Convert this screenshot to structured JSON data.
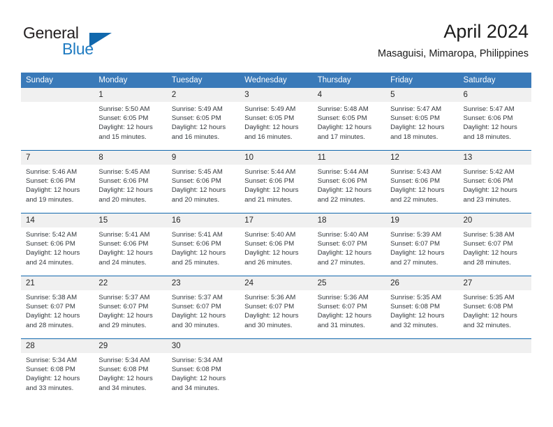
{
  "brand": {
    "name_part1": "General",
    "name_part2": "Blue"
  },
  "header": {
    "month_title": "April 2024",
    "location": "Masaguisi, Mimaropa, Philippines"
  },
  "colors": {
    "header_blue": "#3a7ab9",
    "accent_blue": "#1168ad",
    "daynum_bg": "#f0f0f0"
  },
  "weekday_headers": [
    "Sunday",
    "Monday",
    "Tuesday",
    "Wednesday",
    "Thursday",
    "Friday",
    "Saturday"
  ],
  "weeks": [
    [
      {
        "day": "",
        "sunrise": "",
        "sunset": "",
        "daylight1": "",
        "daylight2": ""
      },
      {
        "day": "1",
        "sunrise": "Sunrise: 5:50 AM",
        "sunset": "Sunset: 6:05 PM",
        "daylight1": "Daylight: 12 hours",
        "daylight2": "and 15 minutes."
      },
      {
        "day": "2",
        "sunrise": "Sunrise: 5:49 AM",
        "sunset": "Sunset: 6:05 PM",
        "daylight1": "Daylight: 12 hours",
        "daylight2": "and 16 minutes."
      },
      {
        "day": "3",
        "sunrise": "Sunrise: 5:49 AM",
        "sunset": "Sunset: 6:05 PM",
        "daylight1": "Daylight: 12 hours",
        "daylight2": "and 16 minutes."
      },
      {
        "day": "4",
        "sunrise": "Sunrise: 5:48 AM",
        "sunset": "Sunset: 6:05 PM",
        "daylight1": "Daylight: 12 hours",
        "daylight2": "and 17 minutes."
      },
      {
        "day": "5",
        "sunrise": "Sunrise: 5:47 AM",
        "sunset": "Sunset: 6:05 PM",
        "daylight1": "Daylight: 12 hours",
        "daylight2": "and 18 minutes."
      },
      {
        "day": "6",
        "sunrise": "Sunrise: 5:47 AM",
        "sunset": "Sunset: 6:06 PM",
        "daylight1": "Daylight: 12 hours",
        "daylight2": "and 18 minutes."
      }
    ],
    [
      {
        "day": "7",
        "sunrise": "Sunrise: 5:46 AM",
        "sunset": "Sunset: 6:06 PM",
        "daylight1": "Daylight: 12 hours",
        "daylight2": "and 19 minutes."
      },
      {
        "day": "8",
        "sunrise": "Sunrise: 5:45 AM",
        "sunset": "Sunset: 6:06 PM",
        "daylight1": "Daylight: 12 hours",
        "daylight2": "and 20 minutes."
      },
      {
        "day": "9",
        "sunrise": "Sunrise: 5:45 AM",
        "sunset": "Sunset: 6:06 PM",
        "daylight1": "Daylight: 12 hours",
        "daylight2": "and 20 minutes."
      },
      {
        "day": "10",
        "sunrise": "Sunrise: 5:44 AM",
        "sunset": "Sunset: 6:06 PM",
        "daylight1": "Daylight: 12 hours",
        "daylight2": "and 21 minutes."
      },
      {
        "day": "11",
        "sunrise": "Sunrise: 5:44 AM",
        "sunset": "Sunset: 6:06 PM",
        "daylight1": "Daylight: 12 hours",
        "daylight2": "and 22 minutes."
      },
      {
        "day": "12",
        "sunrise": "Sunrise: 5:43 AM",
        "sunset": "Sunset: 6:06 PM",
        "daylight1": "Daylight: 12 hours",
        "daylight2": "and 22 minutes."
      },
      {
        "day": "13",
        "sunrise": "Sunrise: 5:42 AM",
        "sunset": "Sunset: 6:06 PM",
        "daylight1": "Daylight: 12 hours",
        "daylight2": "and 23 minutes."
      }
    ],
    [
      {
        "day": "14",
        "sunrise": "Sunrise: 5:42 AM",
        "sunset": "Sunset: 6:06 PM",
        "daylight1": "Daylight: 12 hours",
        "daylight2": "and 24 minutes."
      },
      {
        "day": "15",
        "sunrise": "Sunrise: 5:41 AM",
        "sunset": "Sunset: 6:06 PM",
        "daylight1": "Daylight: 12 hours",
        "daylight2": "and 24 minutes."
      },
      {
        "day": "16",
        "sunrise": "Sunrise: 5:41 AM",
        "sunset": "Sunset: 6:06 PM",
        "daylight1": "Daylight: 12 hours",
        "daylight2": "and 25 minutes."
      },
      {
        "day": "17",
        "sunrise": "Sunrise: 5:40 AM",
        "sunset": "Sunset: 6:06 PM",
        "daylight1": "Daylight: 12 hours",
        "daylight2": "and 26 minutes."
      },
      {
        "day": "18",
        "sunrise": "Sunrise: 5:40 AM",
        "sunset": "Sunset: 6:07 PM",
        "daylight1": "Daylight: 12 hours",
        "daylight2": "and 27 minutes."
      },
      {
        "day": "19",
        "sunrise": "Sunrise: 5:39 AM",
        "sunset": "Sunset: 6:07 PM",
        "daylight1": "Daylight: 12 hours",
        "daylight2": "and 27 minutes."
      },
      {
        "day": "20",
        "sunrise": "Sunrise: 5:38 AM",
        "sunset": "Sunset: 6:07 PM",
        "daylight1": "Daylight: 12 hours",
        "daylight2": "and 28 minutes."
      }
    ],
    [
      {
        "day": "21",
        "sunrise": "Sunrise: 5:38 AM",
        "sunset": "Sunset: 6:07 PM",
        "daylight1": "Daylight: 12 hours",
        "daylight2": "and 28 minutes."
      },
      {
        "day": "22",
        "sunrise": "Sunrise: 5:37 AM",
        "sunset": "Sunset: 6:07 PM",
        "daylight1": "Daylight: 12 hours",
        "daylight2": "and 29 minutes."
      },
      {
        "day": "23",
        "sunrise": "Sunrise: 5:37 AM",
        "sunset": "Sunset: 6:07 PM",
        "daylight1": "Daylight: 12 hours",
        "daylight2": "and 30 minutes."
      },
      {
        "day": "24",
        "sunrise": "Sunrise: 5:36 AM",
        "sunset": "Sunset: 6:07 PM",
        "daylight1": "Daylight: 12 hours",
        "daylight2": "and 30 minutes."
      },
      {
        "day": "25",
        "sunrise": "Sunrise: 5:36 AM",
        "sunset": "Sunset: 6:07 PM",
        "daylight1": "Daylight: 12 hours",
        "daylight2": "and 31 minutes."
      },
      {
        "day": "26",
        "sunrise": "Sunrise: 5:35 AM",
        "sunset": "Sunset: 6:08 PM",
        "daylight1": "Daylight: 12 hours",
        "daylight2": "and 32 minutes."
      },
      {
        "day": "27",
        "sunrise": "Sunrise: 5:35 AM",
        "sunset": "Sunset: 6:08 PM",
        "daylight1": "Daylight: 12 hours",
        "daylight2": "and 32 minutes."
      }
    ],
    [
      {
        "day": "28",
        "sunrise": "Sunrise: 5:34 AM",
        "sunset": "Sunset: 6:08 PM",
        "daylight1": "Daylight: 12 hours",
        "daylight2": "and 33 minutes."
      },
      {
        "day": "29",
        "sunrise": "Sunrise: 5:34 AM",
        "sunset": "Sunset: 6:08 PM",
        "daylight1": "Daylight: 12 hours",
        "daylight2": "and 34 minutes."
      },
      {
        "day": "30",
        "sunrise": "Sunrise: 5:34 AM",
        "sunset": "Sunset: 6:08 PM",
        "daylight1": "Daylight: 12 hours",
        "daylight2": "and 34 minutes."
      },
      {
        "day": "",
        "sunrise": "",
        "sunset": "",
        "daylight1": "",
        "daylight2": ""
      },
      {
        "day": "",
        "sunrise": "",
        "sunset": "",
        "daylight1": "",
        "daylight2": ""
      },
      {
        "day": "",
        "sunrise": "",
        "sunset": "",
        "daylight1": "",
        "daylight2": ""
      },
      {
        "day": "",
        "sunrise": "",
        "sunset": "",
        "daylight1": "",
        "daylight2": ""
      }
    ]
  ]
}
